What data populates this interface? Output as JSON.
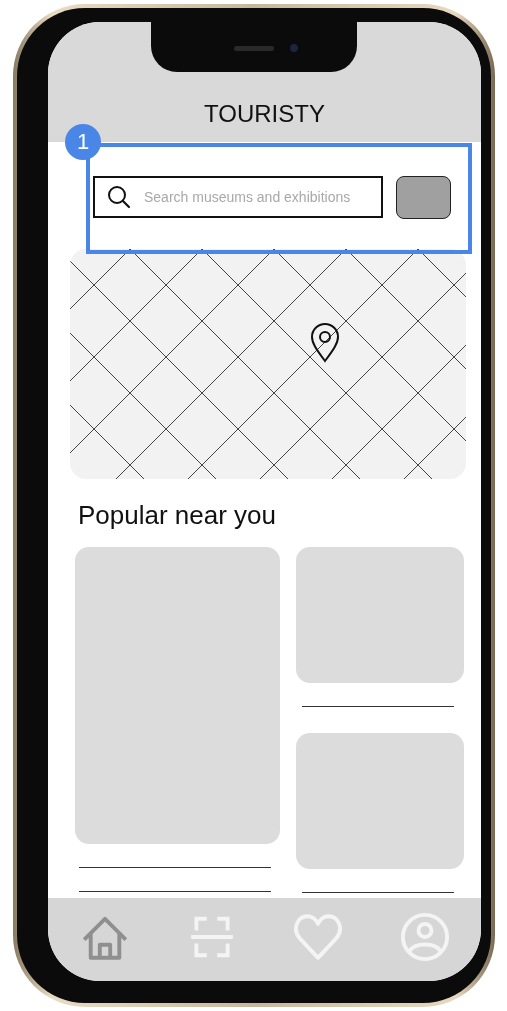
{
  "app": {
    "title": "TOURISTY"
  },
  "annotation": {
    "number": "1"
  },
  "search": {
    "placeholder": "Search museums and exhibitions"
  },
  "section_title": "Popular near you",
  "columns": [
    [
      {
        "kind": "tall"
      }
    ],
    [
      {
        "kind": "short"
      },
      {
        "kind": "short"
      }
    ]
  ],
  "nav": [
    {
      "kind": "home",
      "selected": true
    },
    {
      "kind": "scan",
      "selected": false
    },
    {
      "kind": "heart",
      "selected": false
    },
    {
      "kind": "profile",
      "selected": false
    }
  ]
}
